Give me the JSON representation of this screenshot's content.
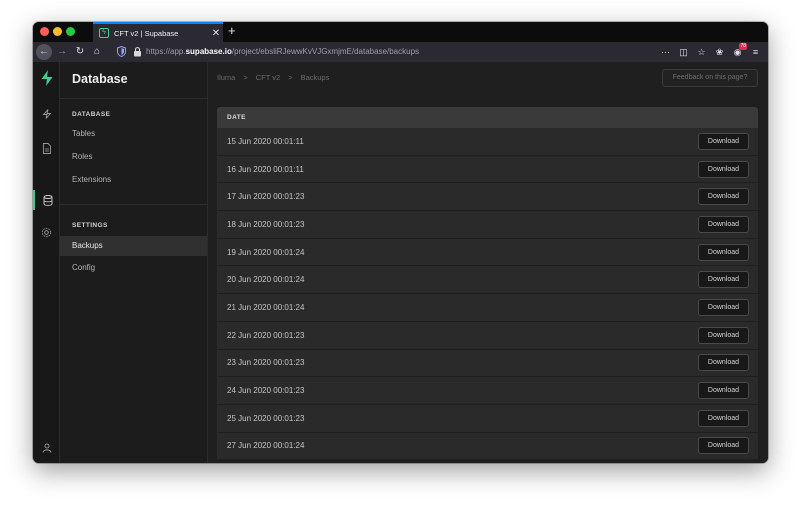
{
  "browser": {
    "tab_title": "CFT v2 | Supabase",
    "tab_close": "✕",
    "new_tab": "+",
    "url_prefix": "https://app.",
    "url_domain": "supabase.io",
    "url_path": "/project/ebsliRJewwKvVJGxmjmE/database/backups",
    "more_icon": "···",
    "extension_badge": "78"
  },
  "brand": {
    "accent": "#3ecf8e"
  },
  "sidebar": {
    "title": "Database",
    "sections": [
      {
        "label": "DATABASE",
        "items": [
          {
            "label": "Tables"
          },
          {
            "label": "Roles"
          },
          {
            "label": "Extensions"
          }
        ]
      },
      {
        "label": "SETTINGS",
        "items": [
          {
            "label": "Backups",
            "active": true
          },
          {
            "label": "Config"
          }
        ]
      }
    ]
  },
  "breadcrumb": {
    "items": [
      "Iluma",
      "CFT v2",
      "Backups"
    ],
    "separator": ">"
  },
  "feedback_label": "Feedback on this page?",
  "table": {
    "header": "DATE",
    "button_label": "Download",
    "rows": [
      {
        "date": "15 Jun 2020 00:01:11"
      },
      {
        "date": "16 Jun 2020 00:01:11"
      },
      {
        "date": "17 Jun 2020 00:01:23"
      },
      {
        "date": "18 Jun 2020 00:01:23"
      },
      {
        "date": "19 Jun 2020 00:01:24"
      },
      {
        "date": "20 Jun 2020 00:01:24"
      },
      {
        "date": "21 Jun 2020 00:01:24"
      },
      {
        "date": "22 Jun 2020 00:01:23"
      },
      {
        "date": "23 Jun 2020 00:01:23"
      },
      {
        "date": "24 Jun 2020 00:01:23"
      },
      {
        "date": "25 Jun 2020 00:01:23"
      },
      {
        "date": "27 Jun 2020 00:01:24"
      }
    ]
  }
}
